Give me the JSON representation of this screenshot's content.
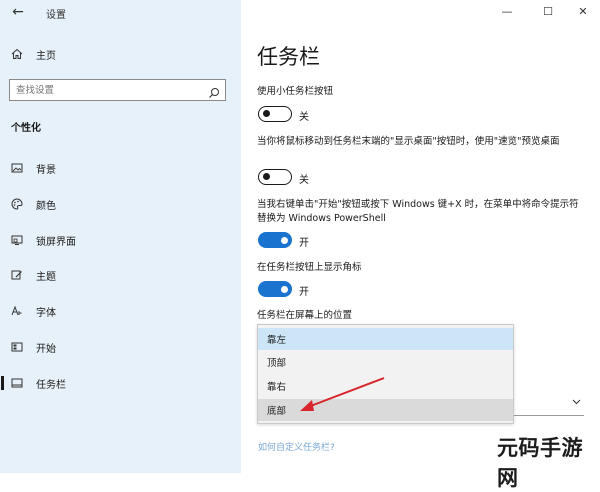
{
  "window": {
    "title": "设置",
    "back_glyph": "←",
    "minimize_glyph": "—",
    "maximize_glyph": "☐",
    "close_glyph": "✕"
  },
  "sidebar": {
    "home_label": "主页",
    "search_placeholder": "查找设置",
    "section_title": "个性化",
    "items": [
      {
        "label": "背景",
        "icon": "image-icon"
      },
      {
        "label": "颜色",
        "icon": "palette-icon"
      },
      {
        "label": "锁屏界面",
        "icon": "lock-screen-icon"
      },
      {
        "label": "主题",
        "icon": "theme-brush-icon"
      },
      {
        "label": "字体",
        "icon": "font-icon"
      },
      {
        "label": "开始",
        "icon": "start-icon"
      },
      {
        "label": "任务栏",
        "icon": "taskbar-icon",
        "active": true
      }
    ]
  },
  "main": {
    "title": "任务栏",
    "settings": [
      {
        "label": "使用小任务栏按钮",
        "state_text": "关",
        "on": false
      },
      {
        "label": "当你将鼠标移动到任务栏末端的\"显示桌面\"按钮时，使用\"速览\"预览桌面",
        "state_text": "关",
        "on": false
      },
      {
        "label": "当我右键单击\"开始\"按钮或按下 Windows 键+X 时，在菜单中将命令提示符替换为 Windows PowerShell",
        "state_text": "开",
        "on": true
      },
      {
        "label": "在任务栏按钮上显示角标",
        "state_text": "开",
        "on": true
      }
    ],
    "position_label": "任务栏在屏幕上的位置",
    "position_options": [
      "靠左",
      "顶部",
      "靠右",
      "底部"
    ],
    "position_selected": "靠左",
    "position_hovered": "底部",
    "help_link": "如何自定义任务栏?"
  },
  "watermark": "元码手游网",
  "colors": {
    "sidebar_bg": "#e6f1f9",
    "accent": "#1a73cf",
    "selected_option": "#cde6f7",
    "annotation_arrow": "#d8262c"
  }
}
